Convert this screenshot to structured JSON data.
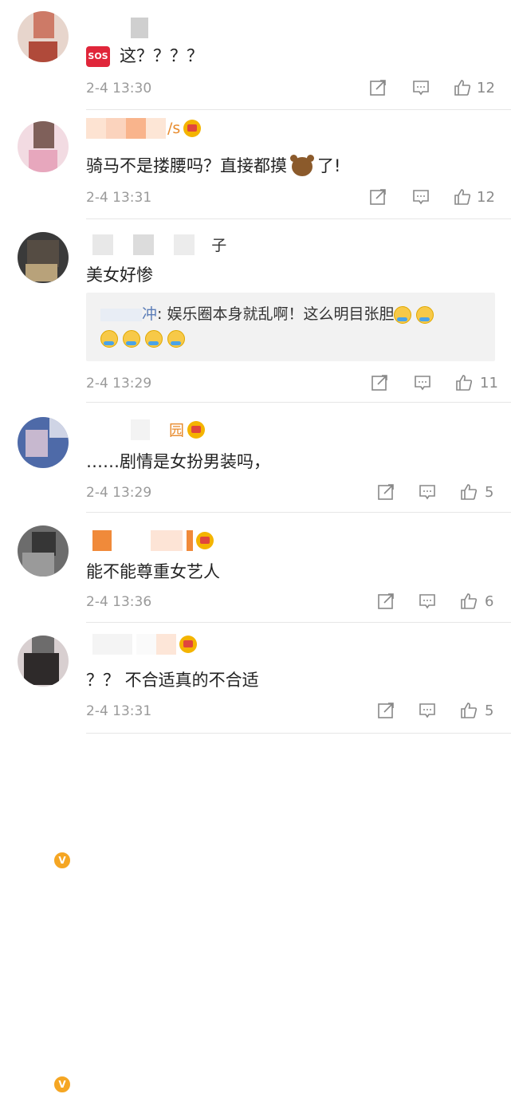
{
  "comments": [
    {
      "name_tail": "",
      "has_crown": false,
      "text": "这？？？？",
      "sos_label": "SOS",
      "time": "2-4 13:30",
      "likes": "12"
    },
    {
      "name_tail": "/s",
      "has_crown": true,
      "text_before": "骑马不是搂腰吗？直接都摸",
      "text_after": "了!",
      "time": "2-4 13:31",
      "likes": "12"
    },
    {
      "name_tail": "子",
      "has_crown": false,
      "text": "美女好惨",
      "reply": {
        "user_suffix": "冲",
        "line1": ": 娱乐圈本身就乱啊！这么明目张胆",
        "emoji": "crying-laughing-icon"
      },
      "time": "2-4 13:29",
      "likes": "11"
    },
    {
      "name_tail": "园",
      "has_crown": true,
      "verified": true,
      "text": "……剧情是女扮男装吗，",
      "time": "2-4 13:29",
      "likes": "5"
    },
    {
      "name_tail": "",
      "has_crown": true,
      "verified": true,
      "text": "能不能尊重女艺人",
      "time": "2-4 13:36",
      "likes": "6"
    },
    {
      "name_tail": "",
      "has_crown": true,
      "text": "？？ 不合适真的不合适",
      "time": "2-4 13:31",
      "likes": "5"
    }
  ],
  "colors": {
    "accent_orange": "#e88b2c",
    "meta_gray": "#9a9a9a",
    "reply_bg": "#f2f2f2",
    "reply_user": "#5b7db8"
  },
  "icons": [
    "share-icon",
    "comment-icon",
    "thumbs-up-icon"
  ]
}
